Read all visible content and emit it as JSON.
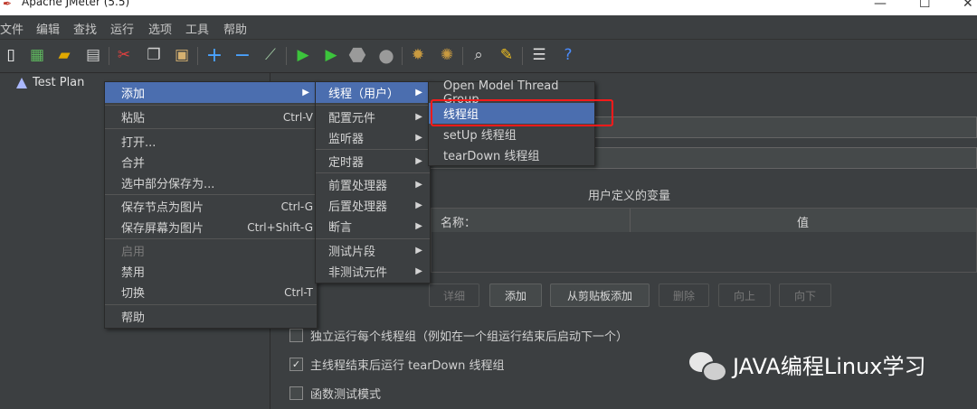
{
  "window": {
    "title": "Apache JMeter (5.5)"
  },
  "menubar": [
    "文件",
    "编辑",
    "查找",
    "运行",
    "选项",
    "工具",
    "帮助"
  ],
  "toolbar_icons": [
    "new-icon",
    "templates-icon",
    "open-icon",
    "save-icon",
    "cut-icon",
    "copy-icon",
    "paste-icon",
    "expand-icon",
    "collapse-icon",
    "toggle-icon",
    "start-icon",
    "start-no-pause-icon",
    "stop-icon",
    "shutdown-icon",
    "clear-icon",
    "clear-all-icon",
    "search-icon",
    "reset-search-icon",
    "function-helper-icon",
    "help-icon"
  ],
  "tree": {
    "root_label": "Test Plan"
  },
  "context_menu": {
    "items": [
      {
        "label": "添加",
        "shortcut": "",
        "submenu": true
      },
      {
        "label": "粘贴",
        "shortcut": "Ctrl-V"
      },
      {
        "label": "打开...",
        "shortcut": ""
      },
      {
        "label": "合并",
        "shortcut": ""
      },
      {
        "label": "选中部分保存为...",
        "shortcut": ""
      },
      {
        "label": "保存节点为图片",
        "shortcut": "Ctrl-G"
      },
      {
        "label": "保存屏幕为图片",
        "shortcut": "Ctrl+Shift-G"
      },
      {
        "label": "启用",
        "shortcut": ""
      },
      {
        "label": "禁用",
        "shortcut": ""
      },
      {
        "label": "切换",
        "shortcut": "Ctrl-T"
      },
      {
        "label": "帮助",
        "shortcut": ""
      }
    ]
  },
  "add_submenu": {
    "items": [
      "线程（用户）",
      "配置元件",
      "监听器",
      "定时器",
      "前置处理器",
      "后置处理器",
      "断言",
      "测试片段",
      "非测试元件"
    ]
  },
  "thread_submenu": {
    "items": [
      "Open Model Thread Group",
      "线程组",
      "setUp 线程组",
      "tearDown 线程组"
    ]
  },
  "main": {
    "vars_title": "用户定义的变量",
    "col_name": "名称：",
    "col_value": "值",
    "buttons": {
      "detail": "详细",
      "add": "添加",
      "add_from_clipboard": "从剪贴板添加",
      "delete": "删除",
      "up": "向上",
      "down": "向下"
    },
    "checkboxes": [
      {
        "label": "独立运行每个线程组（例如在一个组运行结束后启动下一个）",
        "checked": false
      },
      {
        "label": "主线程结束后运行 tearDown 线程组",
        "checked": true
      },
      {
        "label": "函数测试模式",
        "checked": false
      }
    ]
  },
  "watermark": {
    "text": "JAVA编程Linux学习"
  },
  "colors": {
    "background": "#3c3f41",
    "selection": "#4b6eaf",
    "highlight_box": "#ff1a1a"
  }
}
